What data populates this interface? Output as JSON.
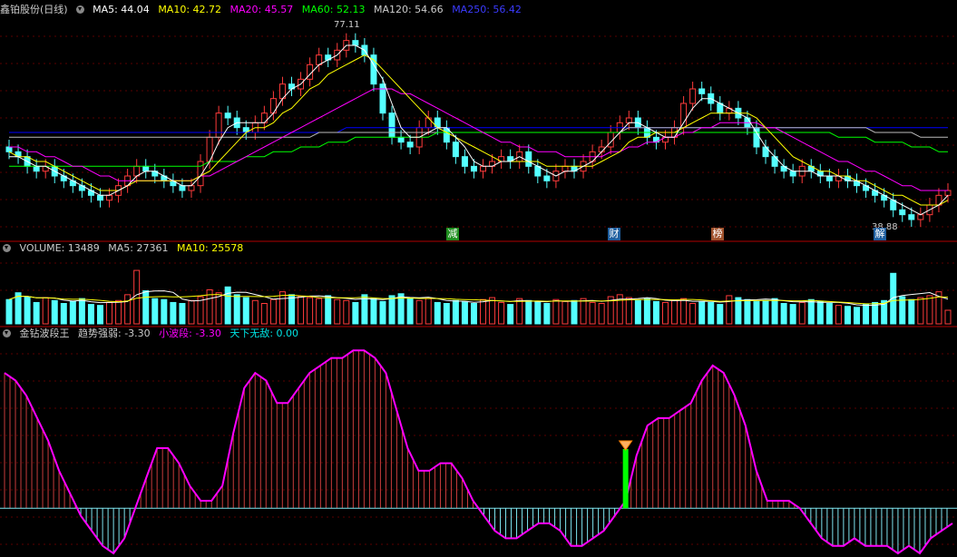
{
  "price_panel": {
    "stock_name": "鑫铂股份(日线)",
    "ma5": "MA5: 44.04",
    "ma10": "MA10: 42.72",
    "ma20": "MA20: 45.57",
    "ma60": "MA60: 52.13",
    "ma120": "MA120: 54.66",
    "ma250": "MA250: 56.42",
    "high_label": "77.11",
    "low_label": "38.88",
    "colors": {
      "ma5": "#ffffff",
      "ma10": "#ffff00",
      "ma20": "#ff00ff",
      "ma60": "#00ff00",
      "ma120": "#cccccc",
      "ma250": "#0000ff"
    }
  },
  "events": [
    {
      "text": "减",
      "color": "#1f8f1f"
    },
    {
      "text": "财",
      "color": "#1f5f9f"
    },
    {
      "text": "榜",
      "color": "#a0522d"
    },
    {
      "text": "解",
      "color": "#1f5f9f"
    }
  ],
  "volume_panel": {
    "volume": "VOLUME: 13489",
    "ma5": "MA5: 27361",
    "ma10": "MA10: 25578"
  },
  "indicator_panel": {
    "name": "金钻波段王",
    "trend": "趋势强弱: -3.30",
    "wave": "小波段: -3.30",
    "invincible": "天下无敌: 0.00"
  },
  "chart_data": [
    {
      "type": "candlestick",
      "panel": "price",
      "ylim": [
        35,
        80
      ],
      "high": 77.11,
      "low": 38.88,
      "close": [
        52,
        51,
        49,
        48,
        49,
        47,
        46,
        45,
        44,
        43,
        42,
        43,
        45,
        47,
        49,
        48,
        47,
        46,
        45,
        44,
        45,
        50,
        55,
        60,
        59,
        57,
        56,
        58,
        60,
        63,
        66,
        65,
        67,
        70,
        72,
        71,
        73,
        75,
        74,
        72,
        66,
        60,
        55,
        54,
        53,
        57,
        59,
        57,
        54,
        51,
        49,
        48,
        49,
        50,
        51,
        50,
        52,
        49,
        47,
        46,
        48,
        49,
        48,
        50,
        52,
        53,
        56,
        58,
        59,
        57,
        55,
        54,
        55,
        57,
        62,
        65,
        64,
        62,
        60,
        61,
        59,
        57,
        53,
        51,
        49,
        48,
        47,
        49,
        48,
        47,
        46,
        47,
        46,
        45,
        44,
        43,
        42,
        40,
        39,
        38,
        39,
        41,
        43,
        44
      ],
      "ma5": [
        51,
        51,
        50,
        49,
        49,
        48,
        47,
        46,
        45,
        44,
        43,
        43,
        44,
        45,
        47,
        48,
        48,
        47,
        46,
        45,
        45,
        47,
        50,
        54,
        57,
        58,
        58,
        58,
        58,
        60,
        63,
        65,
        66,
        68,
        70,
        71,
        72,
        74,
        74,
        73,
        70,
        67,
        62,
        57,
        55,
        55,
        56,
        57,
        57,
        55,
        53,
        50,
        49,
        49,
        50,
        50,
        51,
        50,
        49,
        48,
        47,
        48,
        48,
        49,
        50,
        52,
        54,
        56,
        58,
        58,
        57,
        56,
        55,
        55,
        58,
        61,
        63,
        63,
        62,
        61,
        60,
        59,
        56,
        53,
        51,
        49,
        48,
        48,
        48,
        47,
        47,
        47,
        46,
        46,
        45,
        44,
        43,
        42,
        41,
        40,
        39,
        40,
        41,
        43
      ],
      "ma10": [
        52,
        51,
        51,
        50,
        50,
        49,
        48,
        47,
        46,
        45,
        44,
        44,
        44,
        45,
        46,
        46,
        46,
        46,
        46,
        46,
        46,
        47,
        48,
        50,
        52,
        54,
        56,
        57,
        57,
        58,
        60,
        61,
        63,
        65,
        66,
        68,
        69,
        70,
        71,
        72,
        71,
        69,
        67,
        65,
        63,
        61,
        59,
        57,
        56,
        55,
        54,
        53,
        52,
        51,
        50,
        50,
        50,
        50,
        50,
        49,
        49,
        49,
        49,
        49,
        49,
        50,
        51,
        52,
        54,
        55,
        55,
        56,
        56,
        56,
        57,
        58,
        59,
        60,
        60,
        60,
        60,
        60,
        59,
        57,
        55,
        53,
        51,
        50,
        49,
        48,
        48,
        47,
        47,
        46,
        46,
        45,
        44,
        43,
        43,
        42,
        41,
        41,
        41,
        42
      ],
      "ma20": [
        53,
        53,
        52,
        52,
        51,
        51,
        50,
        49,
        49,
        48,
        47,
        47,
        46,
        46,
        46,
        46,
        46,
        46,
        46,
        46,
        46,
        47,
        47,
        48,
        49,
        50,
        51,
        52,
        53,
        54,
        55,
        56,
        57,
        58,
        59,
        60,
        61,
        62,
        63,
        64,
        65,
        65,
        65,
        64,
        64,
        63,
        62,
        61,
        60,
        59,
        58,
        57,
        56,
        55,
        54,
        54,
        53,
        53,
        52,
        52,
        52,
        51,
        51,
        51,
        51,
        51,
        52,
        52,
        53,
        53,
        54,
        54,
        55,
        55,
        56,
        56,
        57,
        57,
        58,
        58,
        58,
        58,
        58,
        57,
        57,
        56,
        55,
        54,
        53,
        52,
        51,
        50,
        50,
        49,
        48,
        48,
        47,
        46,
        45,
        45,
        44,
        44,
        44,
        44
      ],
      "ma60": [
        49,
        49,
        49,
        49,
        49,
        49,
        49,
        49,
        49,
        49,
        49,
        49,
        49,
        49,
        49,
        49,
        49,
        49,
        49,
        49,
        49,
        49,
        50,
        50,
        50,
        50,
        51,
        51,
        51,
        52,
        52,
        52,
        53,
        53,
        53,
        54,
        54,
        54,
        55,
        55,
        55,
        55,
        55,
        55,
        55,
        55,
        55,
        56,
        56,
        56,
        56,
        56,
        56,
        56,
        56,
        56,
        56,
        56,
        56,
        56,
        56,
        56,
        56,
        56,
        56,
        56,
        56,
        56,
        56,
        56,
        56,
        56,
        56,
        56,
        56,
        56,
        56,
        56,
        56,
        56,
        56,
        56,
        56,
        56,
        56,
        56,
        56,
        56,
        56,
        56,
        56,
        55,
        55,
        55,
        55,
        54,
        54,
        54,
        54,
        53,
        53,
        53,
        52,
        52
      ],
      "ma120": [
        55,
        55,
        55,
        55,
        55,
        55,
        55,
        55,
        55,
        55,
        55,
        55,
        55,
        55,
        55,
        55,
        55,
        55,
        55,
        55,
        55,
        55,
        55,
        55,
        55,
        55,
        55,
        55,
        55,
        55,
        55,
        55,
        55,
        55,
        56,
        56,
        56,
        56,
        56,
        56,
        56,
        56,
        56,
        56,
        56,
        56,
        56,
        56,
        56,
        56,
        56,
        56,
        56,
        56,
        56,
        56,
        56,
        56,
        56,
        56,
        56,
        56,
        56,
        56,
        56,
        56,
        56,
        56,
        57,
        57,
        57,
        57,
        57,
        57,
        57,
        57,
        57,
        57,
        57,
        57,
        57,
        57,
        57,
        57,
        57,
        57,
        57,
        57,
        57,
        57,
        57,
        57,
        57,
        57,
        57,
        56,
        56,
        56,
        56,
        56,
        55,
        55,
        55,
        55
      ],
      "ma250": [
        56,
        56,
        56,
        56,
        56,
        56,
        56,
        56,
        56,
        56,
        56,
        56,
        56,
        56,
        56,
        56,
        56,
        56,
        56,
        56,
        56,
        56,
        56,
        56,
        56,
        56,
        56,
        56,
        56,
        56,
        56,
        56,
        56,
        56,
        56,
        56,
        56,
        57,
        57,
        57,
        57,
        57,
        57,
        57,
        57,
        57,
        57,
        57,
        57,
        57,
        57,
        57,
        57,
        57,
        57,
        57,
        57,
        57,
        57,
        57,
        57,
        57,
        57,
        57,
        57,
        57,
        57,
        57,
        57,
        57,
        57,
        57,
        57,
        57,
        57,
        57,
        57,
        57,
        57,
        57,
        57,
        57,
        57,
        57,
        57,
        57,
        57,
        57,
        57,
        57,
        57,
        57,
        57,
        57,
        57,
        57,
        57,
        57,
        57,
        57,
        57,
        57,
        57,
        57
      ]
    },
    {
      "type": "bar",
      "panel": "volume",
      "ylim": [
        0,
        70000
      ],
      "values": [
        25000,
        32000,
        28000,
        22000,
        27000,
        24000,
        21000,
        23000,
        26000,
        20000,
        19000,
        22000,
        24000,
        30000,
        55000,
        34000,
        26000,
        25000,
        22000,
        21000,
        24000,
        28000,
        35000,
        32000,
        38000,
        30000,
        27000,
        24000,
        21000,
        25000,
        33000,
        30000,
        28000,
        27000,
        26000,
        29000,
        25000,
        24000,
        22000,
        30000,
        26000,
        23000,
        29000,
        31000,
        27000,
        24000,
        26000,
        22000,
        21000,
        24000,
        23000,
        21000,
        25000,
        27000,
        22000,
        20000,
        26000,
        24000,
        23000,
        21000,
        25000,
        23000,
        24000,
        26000,
        22000,
        21000,
        28000,
        30000,
        27000,
        24000,
        26000,
        23000,
        22000,
        24000,
        26000,
        21000,
        23000,
        22000,
        20000,
        29000,
        27000,
        25000,
        23000,
        24000,
        26000,
        21000,
        20000,
        22000,
        25000,
        23000,
        21000,
        19000,
        18000,
        17000,
        20000,
        22000,
        24000,
        52000,
        28000,
        25000,
        27000,
        29000,
        33000,
        14000
      ],
      "ma5": "MA5: 27361",
      "ma10": "MA10: 25578"
    },
    {
      "type": "bar",
      "panel": "indicator",
      "name": "金钻波段王",
      "ylim": [
        -6,
        22
      ],
      "values": [
        18,
        17,
        15,
        12,
        9,
        5,
        2,
        -1,
        -3,
        -5,
        -6,
        -4,
        0,
        4,
        8,
        8,
        6,
        3,
        1,
        1,
        3,
        10,
        16,
        18,
        17,
        14,
        14,
        16,
        18,
        19,
        20,
        20,
        21,
        21,
        20,
        18,
        13,
        8,
        5,
        5,
        6,
        6,
        4,
        1,
        -1,
        -3,
        -4,
        -4,
        -3,
        -2,
        -2,
        -3,
        -5,
        -5,
        -4,
        -3,
        -1,
        1,
        7,
        11,
        12,
        12,
        13,
        14,
        17,
        19,
        18,
        15,
        11,
        5,
        1,
        1,
        1,
        0,
        -2,
        -4,
        -5,
        -5,
        -4,
        -5,
        -5,
        -5,
        -6,
        -5,
        -6,
        -4,
        -3,
        -2
      ],
      "signal_index": 57
    }
  ]
}
